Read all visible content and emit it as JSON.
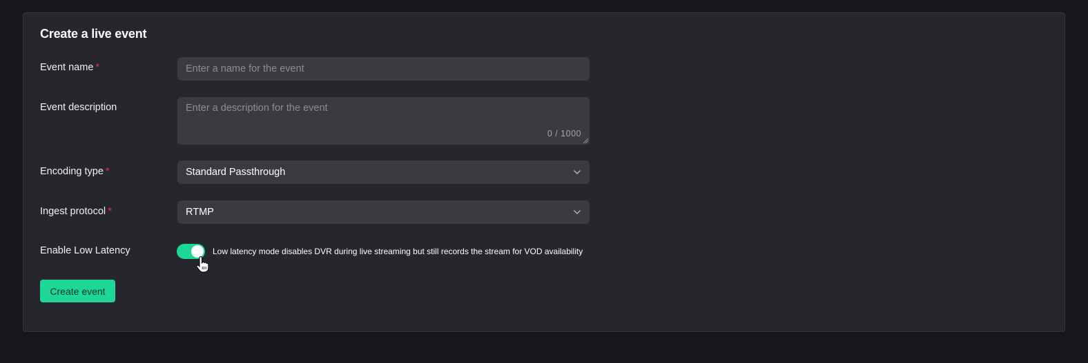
{
  "form": {
    "title": "Create a live event",
    "required_mark": "*",
    "event_name": {
      "label": "Event name",
      "placeholder": "Enter a name for the event",
      "value": ""
    },
    "event_description": {
      "label": "Event description",
      "placeholder": "Enter a description for the event",
      "value": "",
      "counter": "0 / 1000"
    },
    "encoding_type": {
      "label": "Encoding type",
      "selected": "Standard Passthrough"
    },
    "ingest_protocol": {
      "label": "Ingest protocol",
      "selected": "RTMP"
    },
    "low_latency": {
      "label": "Enable Low Latency",
      "enabled": true,
      "description": "Low latency mode disables DVR during live streaming but still records the stream for VOD availability"
    },
    "submit_label": "Create event"
  },
  "colors": {
    "accent": "#1fd696",
    "required": "#e0334a",
    "card_bg": "#26272c",
    "field_bg": "#3a3b41",
    "page_bg": "#16171b"
  },
  "icons": {
    "select_arrow": "chevron-down-icon",
    "cursor": "hand-pointer-icon"
  }
}
